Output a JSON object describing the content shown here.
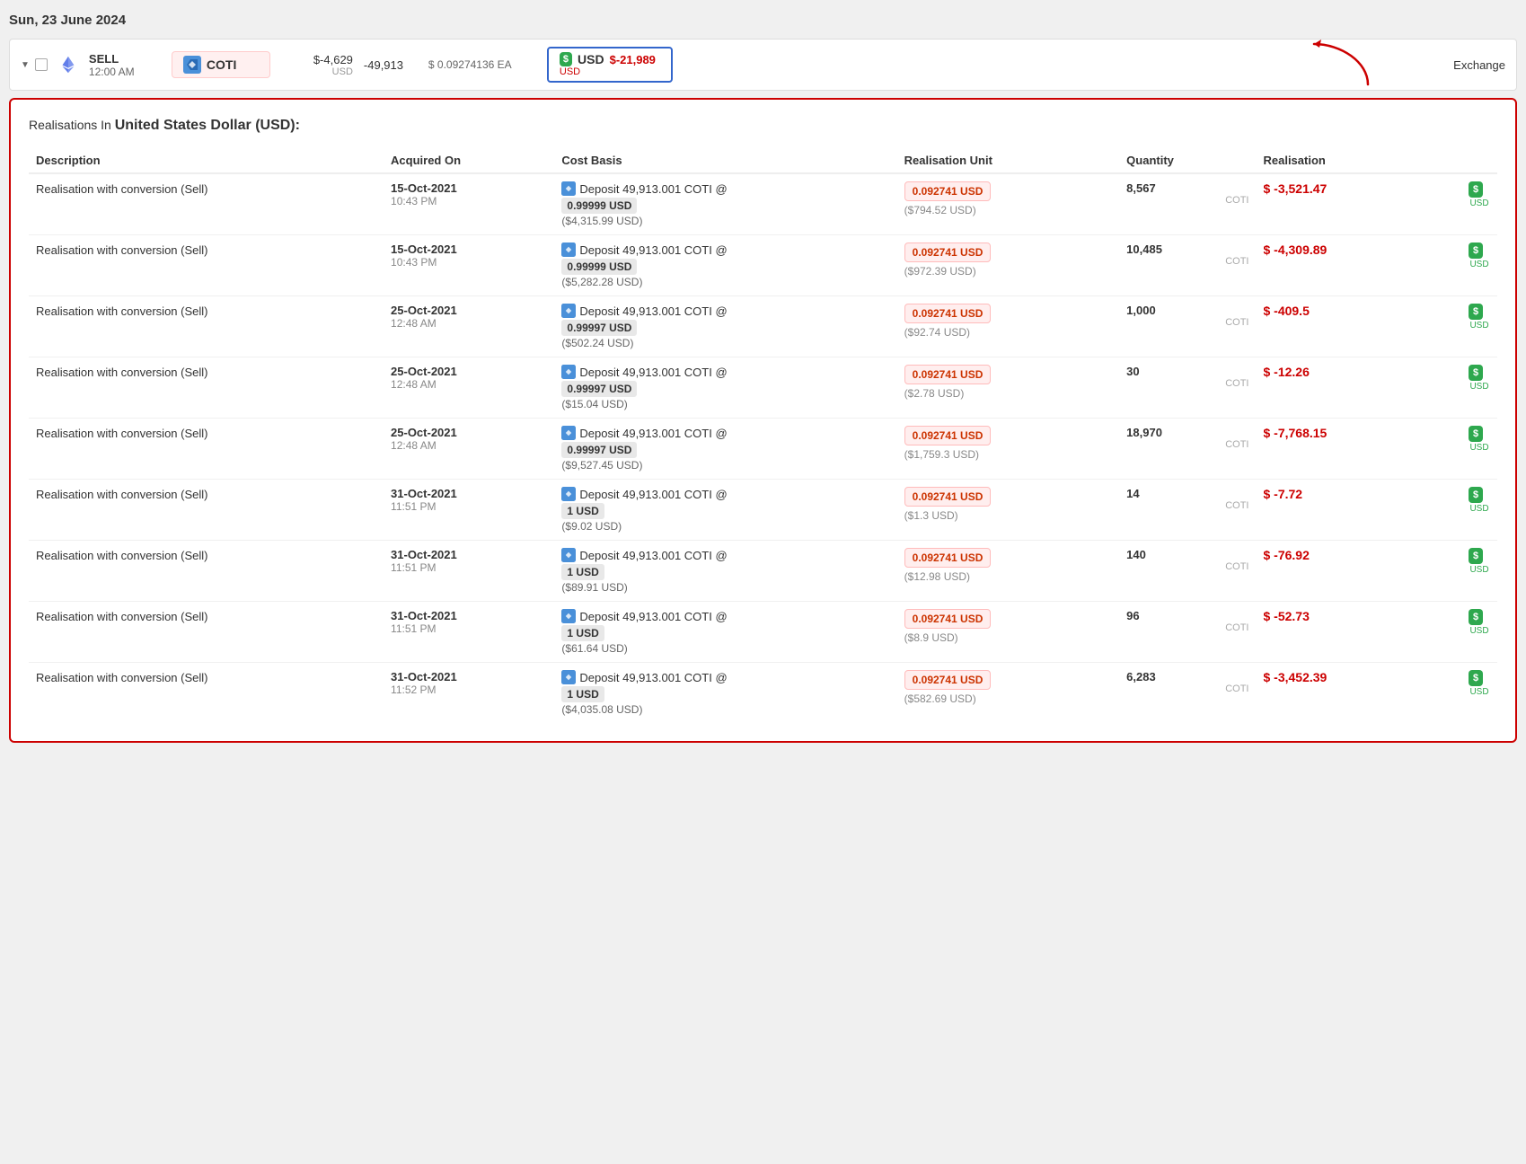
{
  "page": {
    "date": "Sun, 23 June 2024"
  },
  "transaction": {
    "type": "SELL",
    "time": "12:00 AM",
    "asset_name": "COTI",
    "amount_value": "$-4,629",
    "amount_currency": "USD",
    "quantity": "-49,913",
    "price": "$ 0.09274136 EA",
    "usd_amount": "$-21,989",
    "usd_currency": "USD",
    "usd_label": "USD",
    "exchange": "Exchange"
  },
  "realisations": {
    "title_prefix": "Realisations In ",
    "title_currency": "United States Dollar (USD):",
    "columns": {
      "description": "Description",
      "acquired_on": "Acquired On",
      "cost_basis": "Cost Basis",
      "realisation_unit": "Realisation Unit",
      "quantity": "Quantity",
      "realisation": "Realisation"
    },
    "rows": [
      {
        "desc": "Realisation with conversion (Sell)",
        "acquired_date": "15-Oct-2021",
        "acquired_time": "10:43 PM",
        "deposit_text": "Deposit 49,913.001 COTI @",
        "cost_badge": "0.99999 USD",
        "cost_usd": "($4,315.99 USD)",
        "real_unit": "0.092741 USD",
        "real_unit_sub": "($794.52 USD)",
        "qty_value": "8,567",
        "qty_asset": "COTI",
        "real_value": "$ -3,521.47",
        "usd_label": "USD"
      },
      {
        "desc": "Realisation with conversion (Sell)",
        "acquired_date": "15-Oct-2021",
        "acquired_time": "10:43 PM",
        "deposit_text": "Deposit 49,913.001 COTI @",
        "cost_badge": "0.99999 USD",
        "cost_usd": "($5,282.28 USD)",
        "real_unit": "0.092741 USD",
        "real_unit_sub": "($972.39 USD)",
        "qty_value": "10,485",
        "qty_asset": "COTI",
        "real_value": "$ -4,309.89",
        "usd_label": "USD"
      },
      {
        "desc": "Realisation with conversion (Sell)",
        "acquired_date": "25-Oct-2021",
        "acquired_time": "12:48 AM",
        "deposit_text": "Deposit 49,913.001 COTI @",
        "cost_badge": "0.99997 USD",
        "cost_usd": "($502.24 USD)",
        "real_unit": "0.092741 USD",
        "real_unit_sub": "($92.74 USD)",
        "qty_value": "1,000",
        "qty_asset": "COTI",
        "real_value": "$ -409.5",
        "usd_label": "USD"
      },
      {
        "desc": "Realisation with conversion (Sell)",
        "acquired_date": "25-Oct-2021",
        "acquired_time": "12:48 AM",
        "deposit_text": "Deposit 49,913.001 COTI @",
        "cost_badge": "0.99997 USD",
        "cost_usd": "($15.04 USD)",
        "real_unit": "0.092741 USD",
        "real_unit_sub": "($2.78 USD)",
        "qty_value": "30",
        "qty_asset": "COTI",
        "real_value": "$ -12.26",
        "usd_label": "USD"
      },
      {
        "desc": "Realisation with conversion (Sell)",
        "acquired_date": "25-Oct-2021",
        "acquired_time": "12:48 AM",
        "deposit_text": "Deposit 49,913.001 COTI @",
        "cost_badge": "0.99997 USD",
        "cost_usd": "($9,527.45 USD)",
        "real_unit": "0.092741 USD",
        "real_unit_sub": "($1,759.3 USD)",
        "qty_value": "18,970",
        "qty_asset": "COTI",
        "real_value": "$ -7,768.15",
        "usd_label": "USD"
      },
      {
        "desc": "Realisation with conversion (Sell)",
        "acquired_date": "31-Oct-2021",
        "acquired_time": "11:51 PM",
        "deposit_text": "Deposit 49,913.001 COTI @",
        "cost_badge": "1 USD",
        "cost_usd": "($9.02 USD)",
        "real_unit": "0.092741 USD",
        "real_unit_sub": "($1.3 USD)",
        "qty_value": "14",
        "qty_asset": "COTI",
        "real_value": "$ -7.72",
        "usd_label": "USD"
      },
      {
        "desc": "Realisation with conversion (Sell)",
        "acquired_date": "31-Oct-2021",
        "acquired_time": "11:51 PM",
        "deposit_text": "Deposit 49,913.001 COTI @",
        "cost_badge": "1 USD",
        "cost_usd": "($89.91 USD)",
        "real_unit": "0.092741 USD",
        "real_unit_sub": "($12.98 USD)",
        "qty_value": "140",
        "qty_asset": "COTI",
        "real_value": "$ -76.92",
        "usd_label": "USD"
      },
      {
        "desc": "Realisation with conversion (Sell)",
        "acquired_date": "31-Oct-2021",
        "acquired_time": "11:51 PM",
        "deposit_text": "Deposit 49,913.001 COTI @",
        "cost_badge": "1 USD",
        "cost_usd": "($61.64 USD)",
        "real_unit": "0.092741 USD",
        "real_unit_sub": "($8.9 USD)",
        "qty_value": "96",
        "qty_asset": "COTI",
        "real_value": "$ -52.73",
        "usd_label": "USD"
      },
      {
        "desc": "Realisation with conversion (Sell)",
        "acquired_date": "31-Oct-2021",
        "acquired_time": "11:52 PM",
        "deposit_text": "Deposit 49,913.001 COTI @",
        "cost_badge": "1 USD",
        "cost_usd": "($4,035.08 USD)",
        "real_unit": "0.092741 USD",
        "real_unit_sub": "($582.69 USD)",
        "qty_value": "6,283",
        "qty_asset": "COTI",
        "real_value": "$ -3,452.39",
        "usd_label": "USD"
      }
    ]
  }
}
